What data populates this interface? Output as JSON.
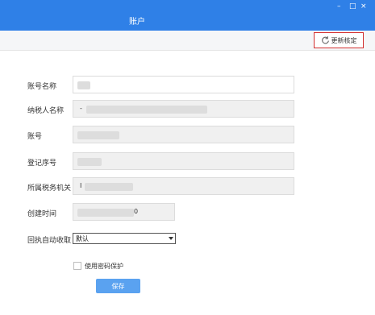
{
  "window": {
    "title": "账户",
    "controls": [
      "–",
      "□",
      "×"
    ]
  },
  "toolbar": {
    "refresh_label": "更新核定",
    "refresh_icon": "refresh-icon"
  },
  "form": {
    "account_name_label": "账号名称",
    "taxpayer_name_label": "纳税人名称",
    "taxpayer_name_partial": "-",
    "account_label": "账号",
    "registration_label": "登记序号",
    "tax_authority_label": "所属税务机关",
    "tax_authority_partial": "I",
    "create_time_label": "创建时间",
    "create_time_partial": "0",
    "auto_receipt_label": "回执自动收取",
    "auto_receipt_value": "默认",
    "password_protect_label": "使用密码保护",
    "save_label": "保存"
  }
}
